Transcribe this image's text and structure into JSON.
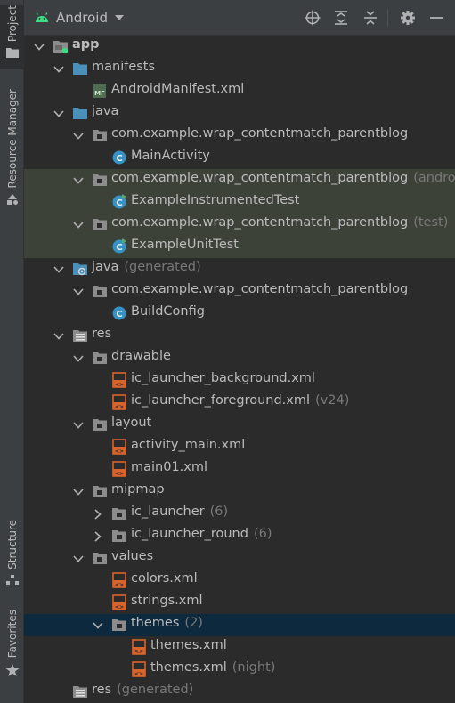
{
  "sidebar": {
    "project_label": "Project",
    "resource_manager_label": "Resource Manager",
    "structure_label": "Structure",
    "favorites_label": "Favorites"
  },
  "toolbar": {
    "view_label": "Android"
  },
  "tree": [
    {
      "label": "app",
      "suffix": "",
      "icon": "module-folder-icon",
      "expanded": true
    },
    {
      "label": "manifests",
      "suffix": "",
      "icon": "folder-icon",
      "expanded": true
    },
    {
      "label": "AndroidManifest.xml",
      "suffix": "",
      "icon": "manifest-file-icon"
    },
    {
      "label": "java",
      "suffix": "",
      "icon": "folder-icon",
      "expanded": true
    },
    {
      "label": "com.example.wrap_contentmatch_parentblog",
      "suffix": "",
      "icon": "package-icon",
      "expanded": true
    },
    {
      "label": "MainActivity",
      "suffix": "",
      "icon": "class-icon"
    },
    {
      "label": "com.example.wrap_contentmatch_parentblog",
      "suffix": "(androidTest)",
      "icon": "package-icon",
      "expanded": true
    },
    {
      "label": "ExampleInstrumentedTest",
      "suffix": "",
      "icon": "test-class-icon"
    },
    {
      "label": "com.example.wrap_contentmatch_parentblog",
      "suffix": "(test)",
      "icon": "package-icon",
      "expanded": true
    },
    {
      "label": "ExampleUnitTest",
      "suffix": "",
      "icon": "test-class-icon"
    },
    {
      "label": "java",
      "suffix": "(generated)",
      "icon": "generated-folder-icon",
      "expanded": true
    },
    {
      "label": "com.example.wrap_contentmatch_parentblog",
      "suffix": "",
      "icon": "package-icon",
      "expanded": true
    },
    {
      "label": "BuildConfig",
      "suffix": "",
      "icon": "class-icon"
    },
    {
      "label": "res",
      "suffix": "",
      "icon": "res-folder-icon",
      "expanded": true
    },
    {
      "label": "drawable",
      "suffix": "",
      "icon": "package-icon",
      "expanded": true
    },
    {
      "label": "ic_launcher_background.xml",
      "suffix": "",
      "icon": "xml-file-icon"
    },
    {
      "label": "ic_launcher_foreground.xml",
      "suffix": "(v24)",
      "icon": "xml-file-icon"
    },
    {
      "label": "layout",
      "suffix": "",
      "icon": "package-icon",
      "expanded": true
    },
    {
      "label": "activity_main.xml",
      "suffix": "",
      "icon": "xml-file-icon"
    },
    {
      "label": "main01.xml",
      "suffix": "",
      "icon": "xml-file-icon"
    },
    {
      "label": "mipmap",
      "suffix": "",
      "icon": "package-icon",
      "expanded": true
    },
    {
      "label": "ic_launcher",
      "suffix": "(6)",
      "icon": "package-icon",
      "expanded": false
    },
    {
      "label": "ic_launcher_round",
      "suffix": "(6)",
      "icon": "package-icon",
      "expanded": false
    },
    {
      "label": "values",
      "suffix": "",
      "icon": "package-icon",
      "expanded": true
    },
    {
      "label": "colors.xml",
      "suffix": "",
      "icon": "xml-file-icon"
    },
    {
      "label": "strings.xml",
      "suffix": "",
      "icon": "xml-file-icon"
    },
    {
      "label": "themes",
      "suffix": "(2)",
      "icon": "package-icon",
      "expanded": true
    },
    {
      "label": "themes.xml",
      "suffix": "",
      "icon": "xml-file-icon"
    },
    {
      "label": "themes.xml",
      "suffix": "(night)",
      "icon": "xml-file-icon"
    },
    {
      "label": "res",
      "suffix": "(generated)",
      "icon": "res-folder-icon"
    }
  ],
  "colors": {
    "background": "#2b2b2b",
    "toolbar": "#3c3f41",
    "selection": "#0d293e",
    "test_highlight": "#3d4238",
    "folder": "#4a90b8",
    "xml_file": "#d8632b",
    "class": "#3592c4",
    "android_green": "#3ddc84"
  }
}
